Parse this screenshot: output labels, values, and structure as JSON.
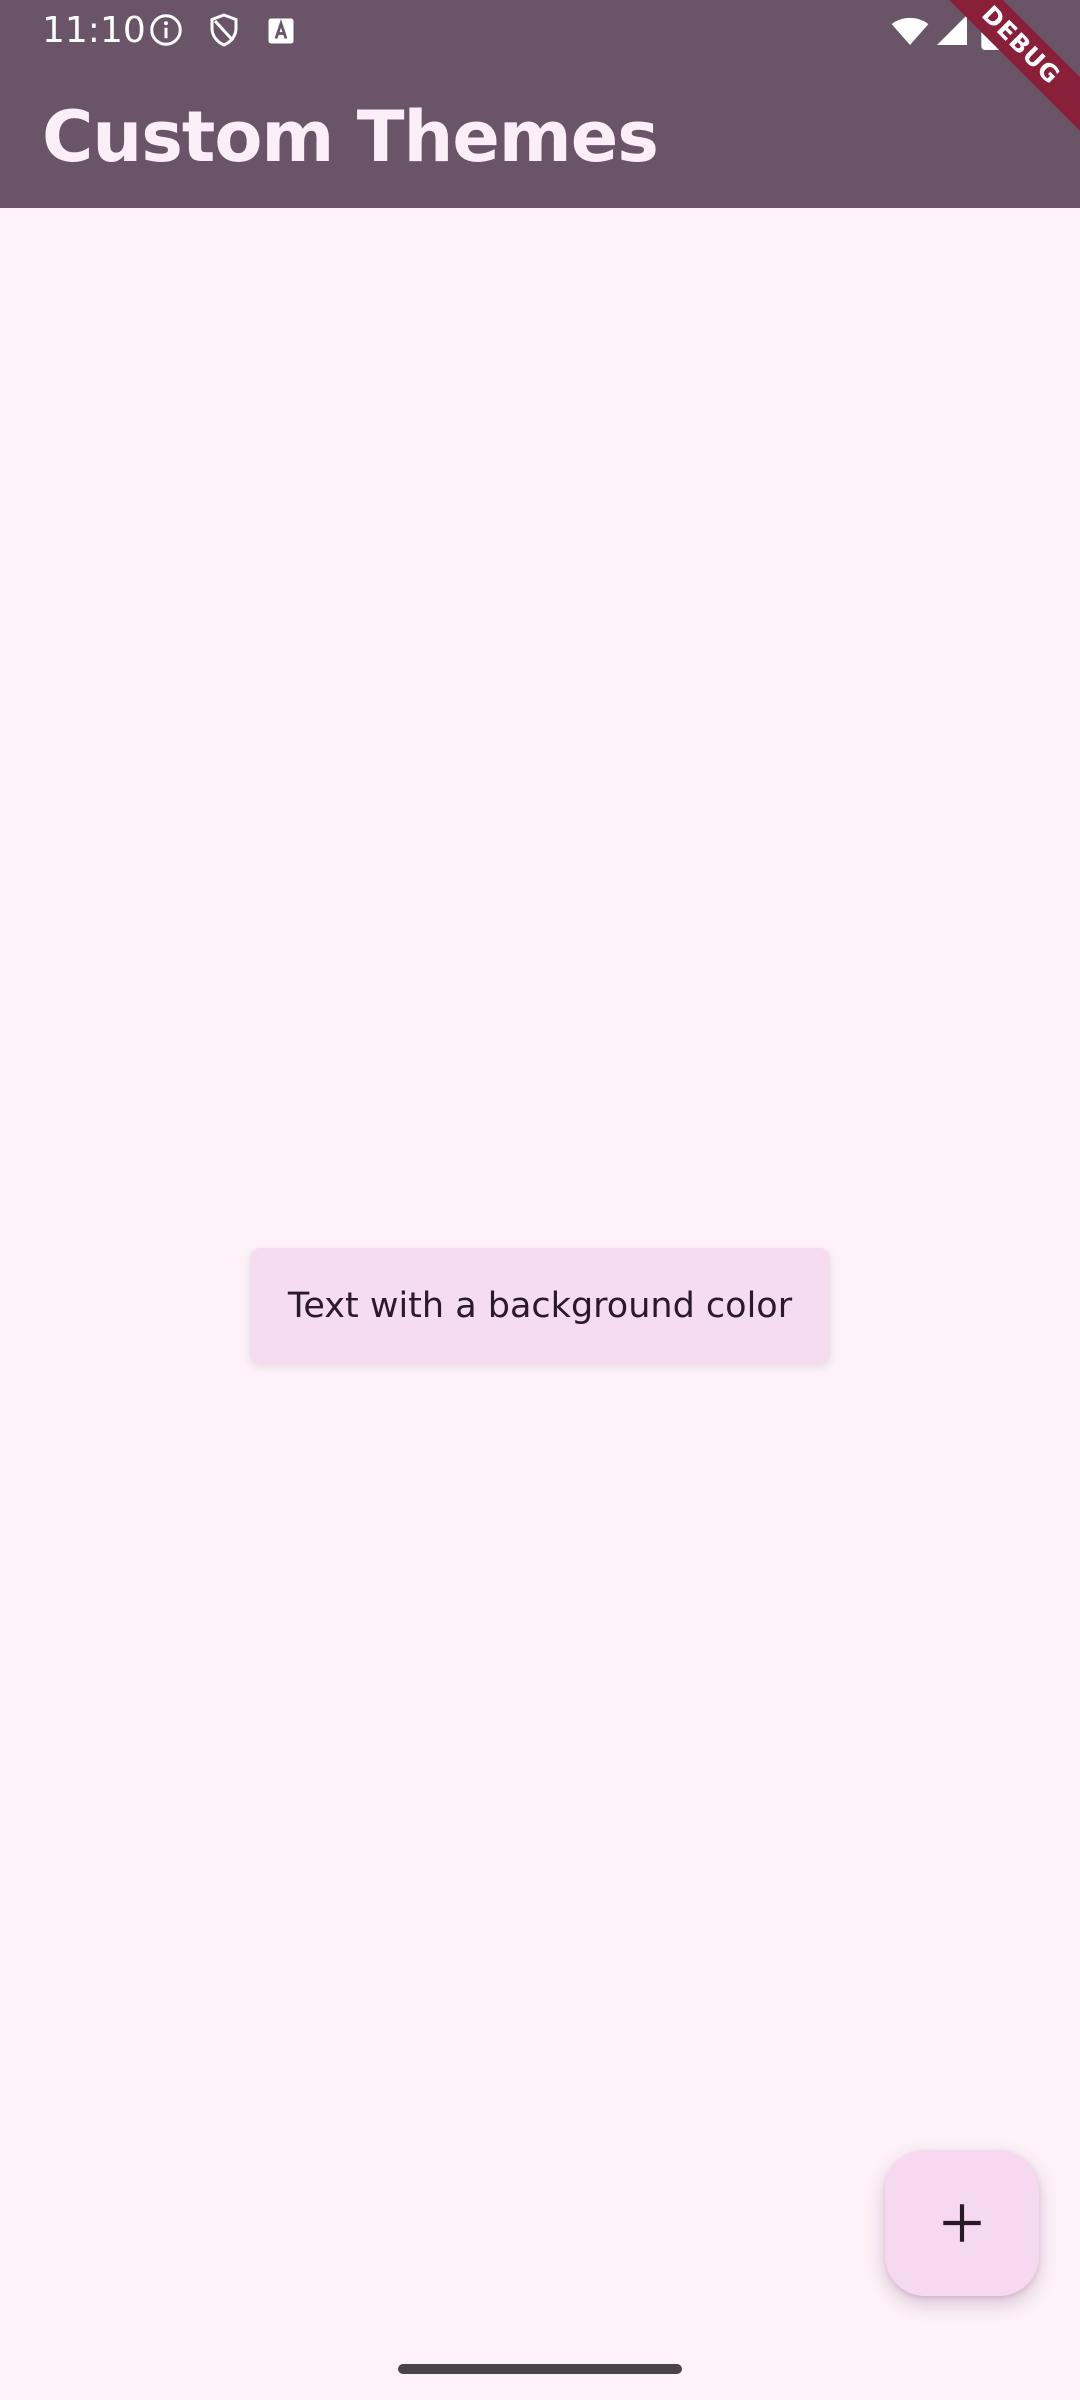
{
  "status_bar": {
    "time": "11:10",
    "icons": [
      "info-icon",
      "shield-icon",
      "a-badge-icon",
      "wifi-icon",
      "signal-icon",
      "battery-icon"
    ]
  },
  "app_bar": {
    "title": "Custom Themes",
    "background_color": "#6a5468",
    "title_color": "#fbeef8"
  },
  "debug_banner": {
    "label": "DEBUG",
    "color": "#8a1f3a"
  },
  "content": {
    "chip_text": "Text with a background color",
    "chip_color": "#f6dcf1",
    "background_color": "#fcf2f8"
  },
  "fab": {
    "icon": "plus-icon",
    "color": "#f6d8f0"
  }
}
